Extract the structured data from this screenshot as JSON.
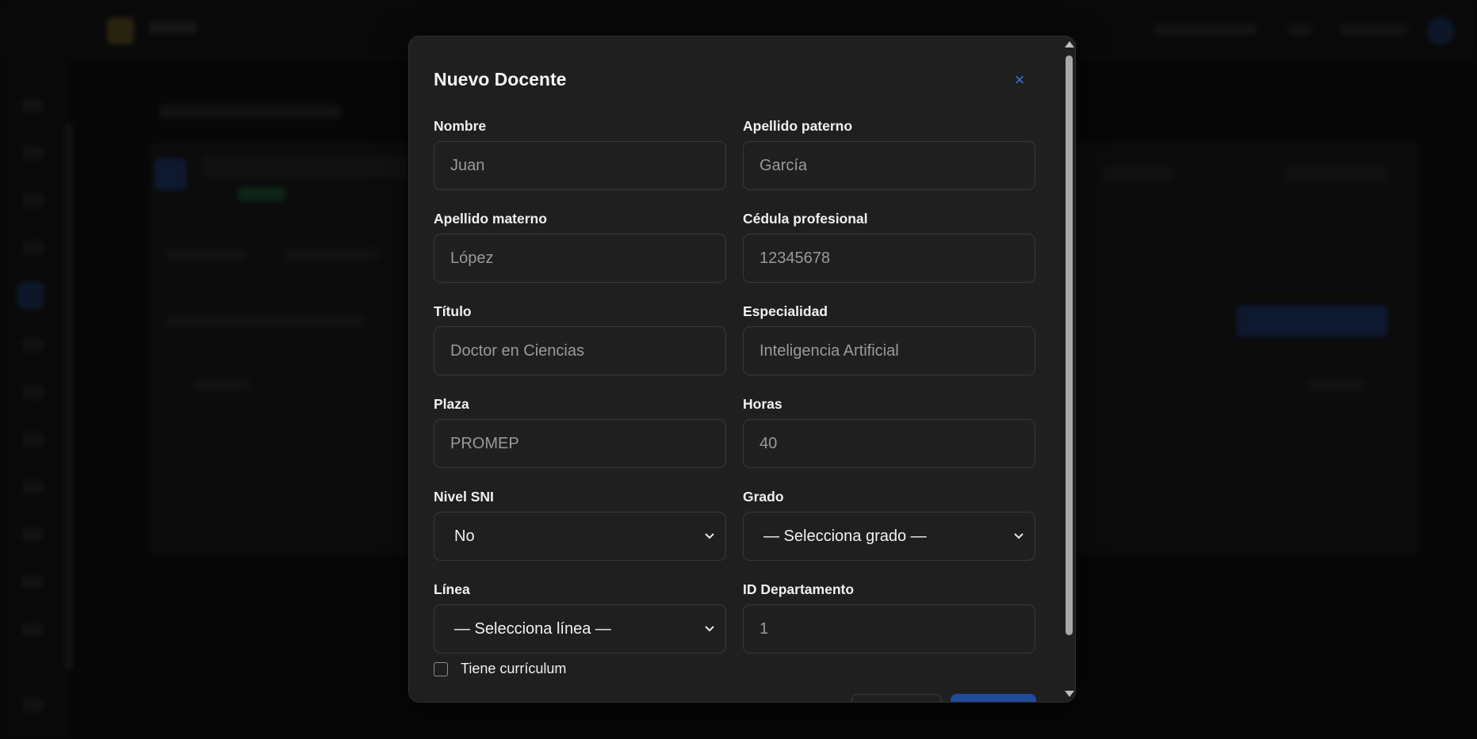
{
  "modal": {
    "title": "Nuevo Docente",
    "close_icon": "×"
  },
  "fields": [
    {
      "label": "Nombre",
      "type": "input",
      "placeholder": "Juan"
    },
    {
      "label": "Apellido paterno",
      "type": "input",
      "placeholder": "García"
    },
    {
      "label": "Apellido materno",
      "type": "input",
      "placeholder": "López"
    },
    {
      "label": "Cédula profesional",
      "type": "input",
      "placeholder": "12345678"
    },
    {
      "label": "Título",
      "type": "input",
      "placeholder": "Doctor en Ciencias"
    },
    {
      "label": "Especialidad",
      "type": "input",
      "placeholder": "Inteligencia Artificial"
    },
    {
      "label": "Plaza",
      "type": "input",
      "placeholder": "PROMEP"
    },
    {
      "label": "Horas",
      "type": "input",
      "placeholder": "40"
    },
    {
      "label": "Nivel SNI",
      "type": "select",
      "value": "No"
    },
    {
      "label": "Grado",
      "type": "select",
      "value": "— Selecciona grado —"
    },
    {
      "label": "Línea",
      "type": "select",
      "value": "— Selecciona línea —"
    },
    {
      "label": "ID Departamento",
      "type": "input",
      "placeholder": "1"
    }
  ],
  "checkbox": {
    "label": "Tiene currículum",
    "checked": false
  },
  "colors": {
    "accent": "#3b6fd4",
    "modal_bg": "#1f1f20",
    "primary_button": "#1f4b9c"
  },
  "icons": {
    "close": "close-icon",
    "select": "chevron-down-icon"
  }
}
